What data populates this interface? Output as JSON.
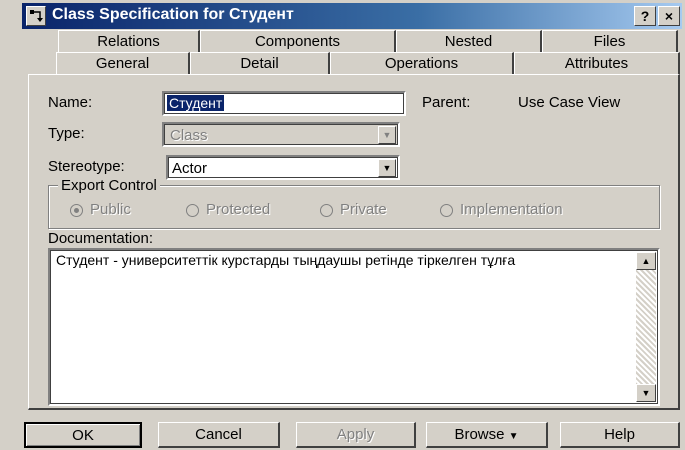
{
  "window": {
    "title": "Class Specification for Студент",
    "help_btn": "?",
    "close_btn": "×"
  },
  "tabs_row1": [
    {
      "label": "Relations"
    },
    {
      "label": "Components"
    },
    {
      "label": "Nested"
    },
    {
      "label": "Files"
    }
  ],
  "tabs_row2": [
    {
      "label": "General",
      "active": true
    },
    {
      "label": "Detail"
    },
    {
      "label": "Operations"
    },
    {
      "label": "Attributes"
    }
  ],
  "general": {
    "name_label": "Name:",
    "name_value": "Студент",
    "parent_label": "Parent:",
    "parent_value": "Use Case View",
    "type_label": "Type:",
    "type_value": "Class",
    "stereotype_label": "Stereotype:",
    "stereotype_value": "Actor",
    "export_control_label": "Export Control",
    "export_options": [
      "Public",
      "Protected",
      "Private",
      "Implementation"
    ],
    "export_selected": "Public",
    "documentation_label": "Documentation:",
    "documentation_text": "Студент - университеттік курстарды тыңдаушы ретінде тіркелген тұлға"
  },
  "buttons": {
    "ok": "OK",
    "cancel": "Cancel",
    "apply": "Apply",
    "browse": "Browse",
    "help": "Help"
  },
  "icons": {
    "title_icon": "class-spec-icon",
    "dropdown_arrow": "▼",
    "scroll_up": "▲",
    "scroll_down": "▼",
    "browse_arrow": "▼"
  },
  "colors": {
    "face": "#d4d0c8",
    "title_start": "#0a246a",
    "title_end": "#a6caf0"
  }
}
